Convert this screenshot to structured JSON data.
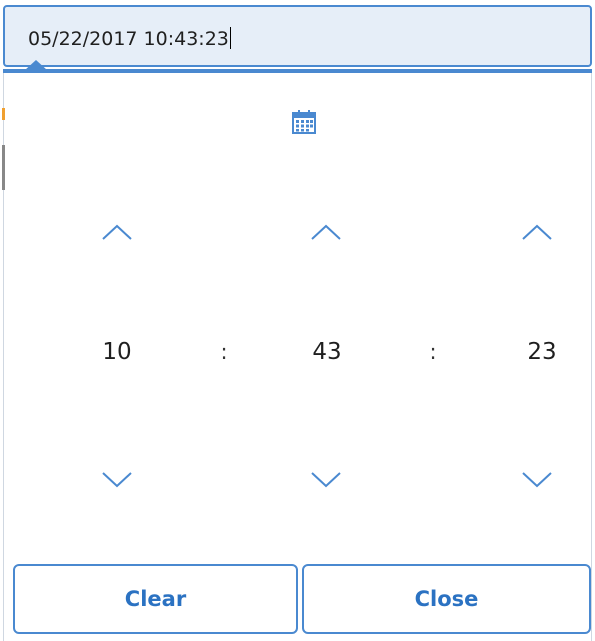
{
  "input": {
    "value": "05/22/2017 10:43:23"
  },
  "picker": {
    "icon": "calendar-icon",
    "hours": "10",
    "minutes": "43",
    "seconds": "23",
    "separator": ":",
    "up_icon": "chevron-up-icon",
    "down_icon": "chevron-down-icon"
  },
  "buttons": {
    "clear": "Clear",
    "close": "Close"
  },
  "colors": {
    "accent": "#4a89d0",
    "button_text": "#2b72c2",
    "input_bg": "#e6eef8"
  }
}
